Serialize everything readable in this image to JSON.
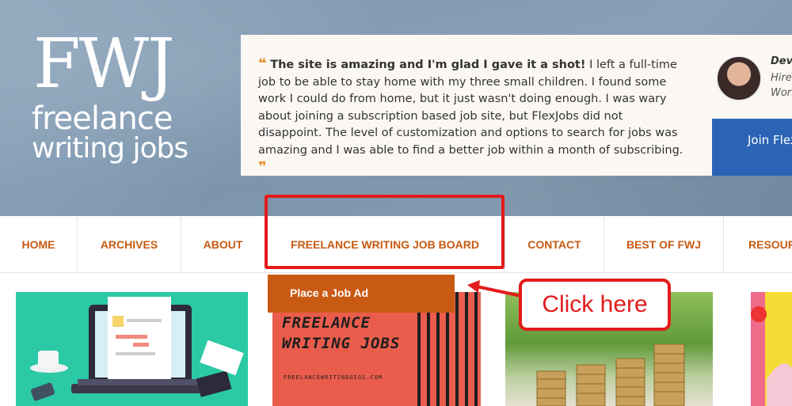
{
  "logo": {
    "line1": "FWJ",
    "line2": "freelance",
    "line3": "writing jobs"
  },
  "testimonial": {
    "bold": "The site is amazing and I'm glad I gave it a shot!",
    "rest": " I left a full-time job to be able to stay home with my three small children. I found some work I could do from home, but it just wasn't doing enough. I was wary about joining a subscription based job site, but FlexJobs did not disappoint. The level of customization and options to search for jobs was amazing and I was able to find a better job within a month of subscribing.",
    "open_quote": "❝",
    "close_quote": "❞",
    "name": "Devy",
    "line2": "Hired",
    "line3": "Work",
    "join_label": "Join Flex"
  },
  "nav": {
    "items": [
      "HOME",
      "ARCHIVES",
      "ABOUT",
      "FREELANCE WRITING JOB BOARD",
      "CONTACT",
      "BEST OF FWJ",
      "RESOUR"
    ]
  },
  "dropdown": {
    "label": "Place a Job Ad"
  },
  "callout": {
    "label": "Click here"
  },
  "thumb2": {
    "title": "FREELANCE WRITING JOBS",
    "url": "FREELANCEWRITINGGIGS.COM"
  },
  "colors": {
    "accent": "#c75a11",
    "highlight": "#e31b1b",
    "join": "#2b64b6"
  }
}
